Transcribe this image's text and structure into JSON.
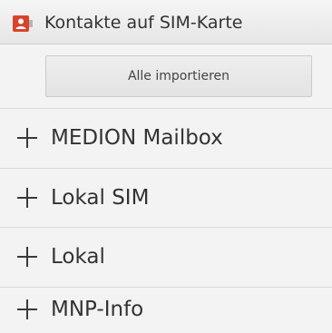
{
  "action_bar": {
    "title": "Kontakte auf SIM-Karte",
    "icon": "contacts-sim-icon"
  },
  "import_button": {
    "label": "Alle importieren"
  },
  "groups": [
    {
      "label": "MEDION Mailbox",
      "icon": "plus-icon"
    },
    {
      "label": "Lokal SIM",
      "icon": "plus-icon"
    },
    {
      "label": "Lokal",
      "icon": "plus-icon"
    },
    {
      "label": "MNP-Info",
      "icon": "plus-icon"
    }
  ],
  "colors": {
    "accent": "#d9432a",
    "text": "#333333",
    "background": "#f3f3f3"
  }
}
